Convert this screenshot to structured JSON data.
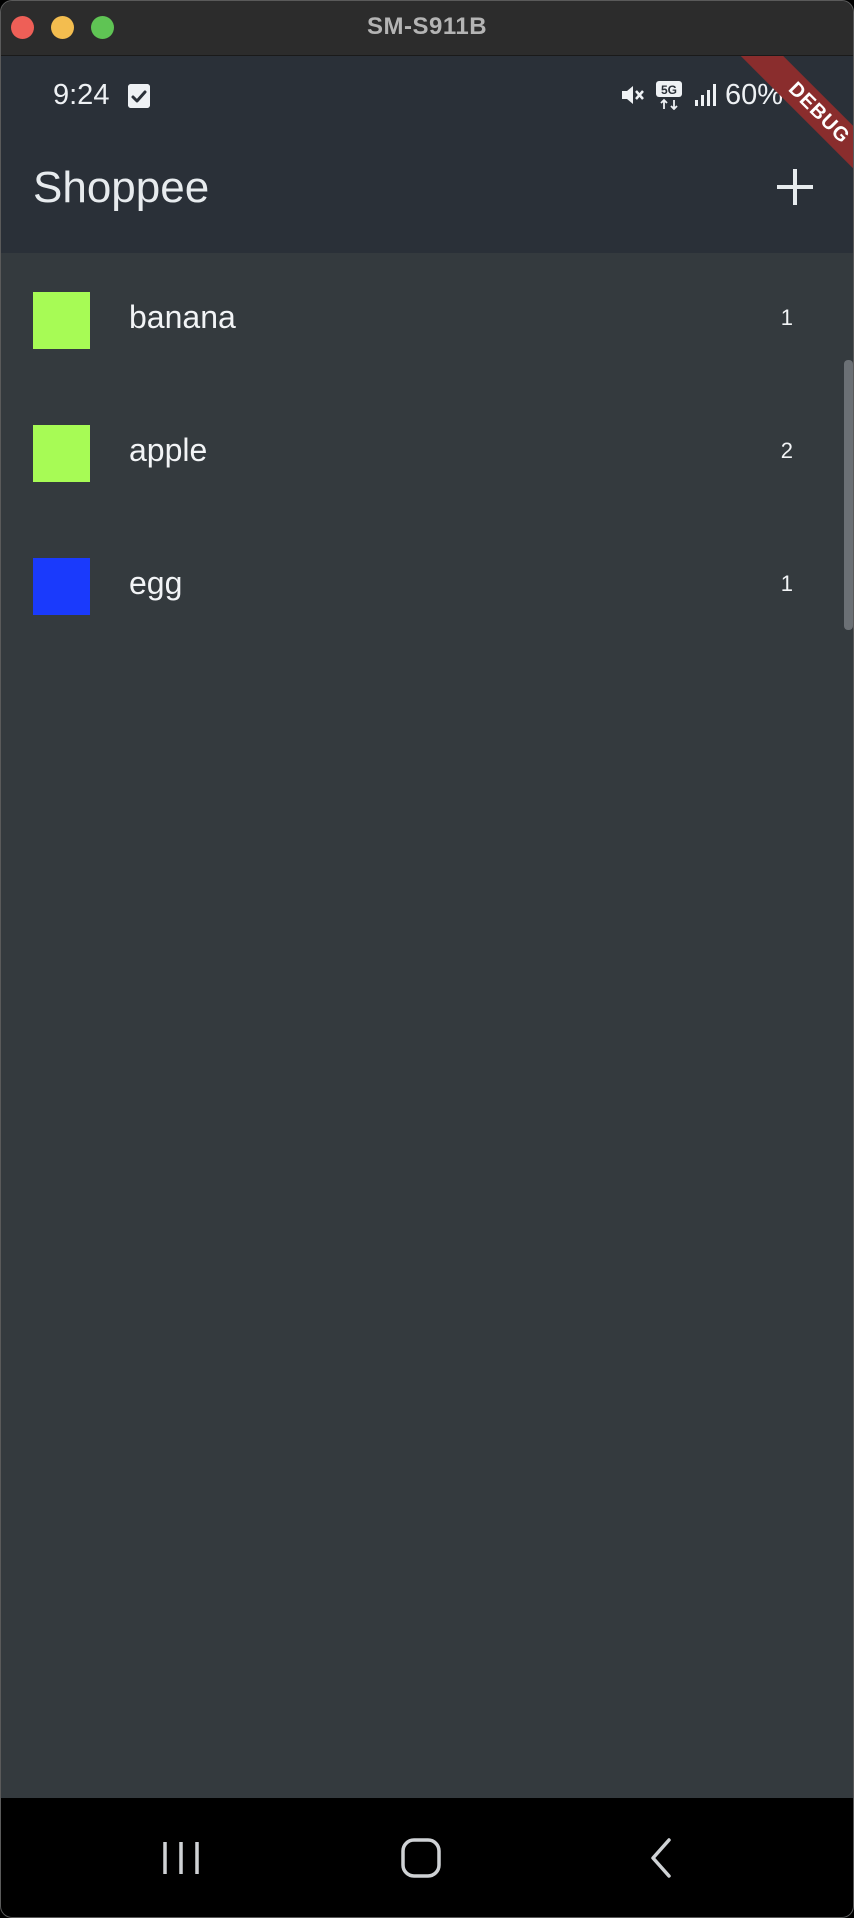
{
  "window": {
    "title": "SM-S911B"
  },
  "status_bar": {
    "time": "9:24",
    "battery_text": "60%",
    "icons": [
      "checkbox-notification-icon",
      "mute-icon",
      "5g-icon",
      "signal-icon",
      "battery-icon"
    ]
  },
  "app_bar": {
    "title": "Shoppee",
    "add_icon": "plus-icon"
  },
  "debug_banner": {
    "label": "DEBUG"
  },
  "items": [
    {
      "name": "banana",
      "quantity": "1",
      "color": "#a7fb55"
    },
    {
      "name": "apple",
      "quantity": "2",
      "color": "#a7fb55"
    },
    {
      "name": "egg",
      "quantity": "1",
      "color": "#1a3afc"
    }
  ],
  "nav_bar": {
    "buttons": [
      "recents-icon",
      "home-icon",
      "back-icon"
    ]
  },
  "colors": {
    "background": "#343a3e",
    "app_bar": "#2a3038",
    "debug_banner": "#8a2d2d"
  }
}
